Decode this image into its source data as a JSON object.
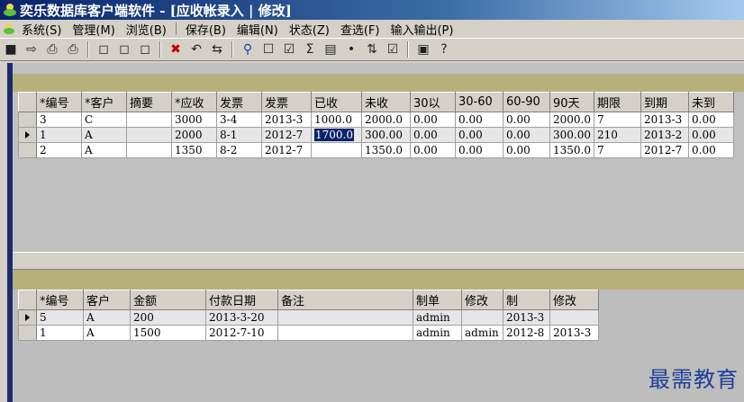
{
  "window": {
    "title": "奕乐数据库客户端软件 - [应收帐录入 | 修改]"
  },
  "menu": [
    {
      "label": "系统(S)"
    },
    {
      "label": "管理(M)"
    },
    {
      "label": "浏览(B)"
    },
    {
      "label": "保存(B)"
    },
    {
      "label": "编辑(N)"
    },
    {
      "label": "状态(Z)"
    },
    {
      "label": "查选(F)"
    },
    {
      "label": "输入输出(P)"
    }
  ],
  "toolbar": {
    "icons": [
      "save-icon",
      "import-icon",
      "print-icon",
      "print-preview-icon",
      "new-doc-icon",
      "copy-doc-icon",
      "paste-doc-icon",
      "delete-icon",
      "undo-icon",
      "replace-icon",
      "find-icon",
      "form-view-icon",
      "checkbox-icon",
      "sum-icon",
      "filter-icon",
      "link-icon",
      "sort-icon",
      "export-icon",
      "screenshot-icon",
      "help-icon"
    ]
  },
  "receivables": {
    "columns": [
      "*编号",
      "*客户",
      "摘要",
      "*应收",
      "发票",
      "发票",
      "已收",
      "未收",
      "30以",
      "30-60",
      "60-90",
      "90天",
      "期限",
      "到期",
      "未到"
    ],
    "rows": [
      [
        "3",
        "C",
        "",
        "3000",
        "3-4",
        "2013-3",
        "1000.0",
        "2000.0",
        "0.00",
        "0.00",
        "0.00",
        "2000.0",
        "7",
        "2013-3",
        "0.00"
      ],
      [
        "1",
        "A",
        "",
        "2000",
        "8-1",
        "2012-7",
        "1700.0",
        "300.00",
        "0.00",
        "0.00",
        "0.00",
        "300.00",
        "210",
        "2013-2",
        "0.00"
      ],
      [
        "2",
        "A",
        "",
        "1350",
        "8-2",
        "2012-7",
        "",
        "1350.0",
        "0.00",
        "0.00",
        "0.00",
        "1350.0",
        "7",
        "2012-7",
        "0.00"
      ]
    ],
    "current_row": 1
  },
  "payments": {
    "columns": [
      "*编号",
      "客户",
      "金额",
      "付款日期",
      "备注",
      "制单",
      "修改",
      "制",
      "修改"
    ],
    "rows": [
      [
        "5",
        "A",
        "200",
        "2013-3-20",
        "",
        "admin",
        "",
        "2013-3",
        ""
      ],
      [
        "1",
        "A",
        "1500",
        "2012-7-10",
        "",
        "admin",
        "admin",
        "2012-8",
        "2013-3"
      ]
    ],
    "current_row": 0
  },
  "watermark": "最需教育",
  "colors": {
    "title_bar": "#0a246a",
    "band": "#b7b07a",
    "selection": "#0a246a",
    "watermark": "#1c3f9a"
  }
}
